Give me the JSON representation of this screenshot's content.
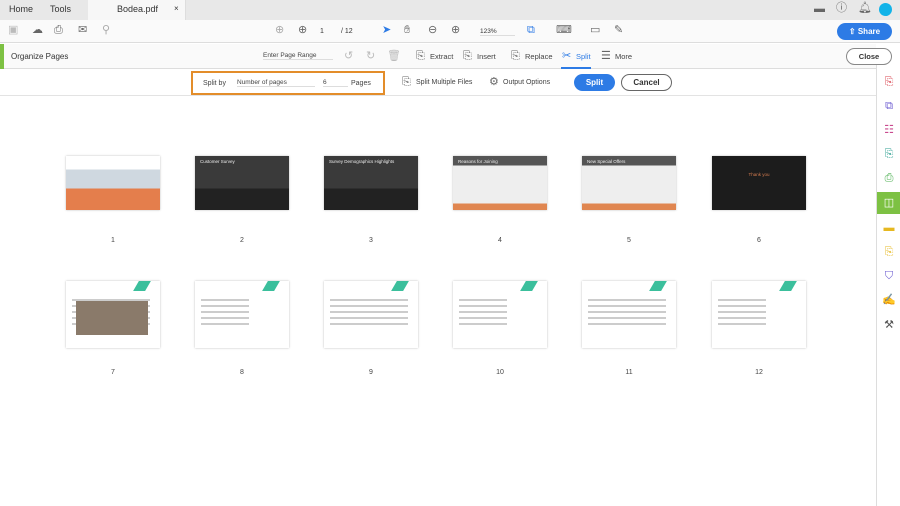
{
  "tabs": {
    "home": "Home",
    "tools": "Tools",
    "document": "Bodea.pdf",
    "close": "×"
  },
  "toolbar": {
    "page_current": "1",
    "page_total": "/ 12",
    "zoom": "123%",
    "share": "Share"
  },
  "organize": {
    "title": "Organize Pages",
    "page_range_placeholder": "Enter Page Range",
    "extract": "Extract",
    "insert": "Insert",
    "replace": "Replace",
    "split": "Split",
    "more": "More",
    "close": "Close"
  },
  "split_bar": {
    "split_by_label": "Split by",
    "split_by_value": "Number of pages",
    "count": "6",
    "pages_label": "Pages",
    "split_multiple": "Split Multiple Files",
    "output_options": "Output Options",
    "split_button": "Split",
    "cancel_button": "Cancel"
  },
  "pages": [
    {
      "number": "1",
      "title": ""
    },
    {
      "number": "2",
      "title": "Customer Survey"
    },
    {
      "number": "3",
      "title": "Survey Demographics Highlights"
    },
    {
      "number": "4",
      "title": "Reasons for Joining"
    },
    {
      "number": "5",
      "title": "New Special Offers"
    },
    {
      "number": "6",
      "title": "Thank you"
    },
    {
      "number": "7",
      "title": ""
    },
    {
      "number": "8",
      "title": ""
    },
    {
      "number": "9",
      "title": ""
    },
    {
      "number": "10",
      "title": ""
    },
    {
      "number": "11",
      "title": ""
    },
    {
      "number": "12",
      "title": ""
    }
  ],
  "colors": {
    "accent": "#2d7be5",
    "highlight": "#e38d2a",
    "organize": "#7dc143"
  }
}
